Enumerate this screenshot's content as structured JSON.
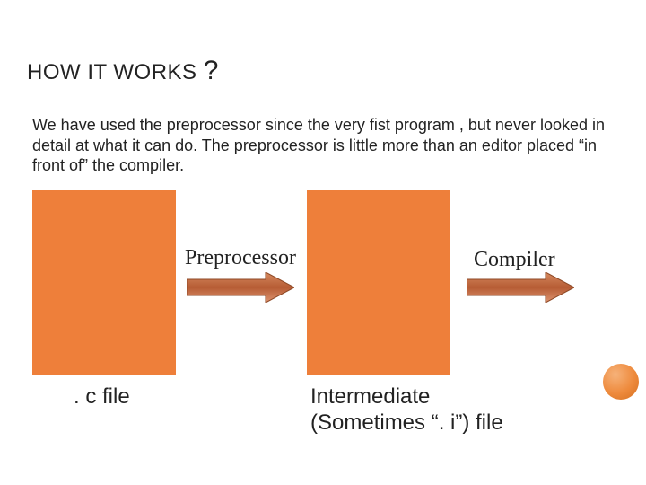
{
  "title_main": "HOW IT WORKS ",
  "title_qmark": "?",
  "paragraph": "We have used the preprocessor since the very fist program , but never looked in detail at what it can do. The preprocessor is little more than an editor placed “in front of” the compiler.",
  "labels": {
    "preprocessor": "Preprocessor",
    "compiler": "Compiler"
  },
  "captions": {
    "c_file": ". c file",
    "intermediate": "Intermediate (Sometimes “. i”) file"
  },
  "colors": {
    "box": "#ee7f3a",
    "arrow_fill": "#c77148",
    "arrow_stroke": "#9a4d29"
  },
  "chart_data": {
    "type": "diagram",
    "nodes": [
      {
        "id": "c_file",
        "label": ". c file"
      },
      {
        "id": "intermediate",
        "label": "Intermediate (Sometimes “. i”) file"
      }
    ],
    "edges": [
      {
        "from": "c_file",
        "to": "intermediate",
        "label": "Preprocessor"
      },
      {
        "from": "intermediate",
        "to": "output",
        "label": "Compiler"
      }
    ]
  }
}
